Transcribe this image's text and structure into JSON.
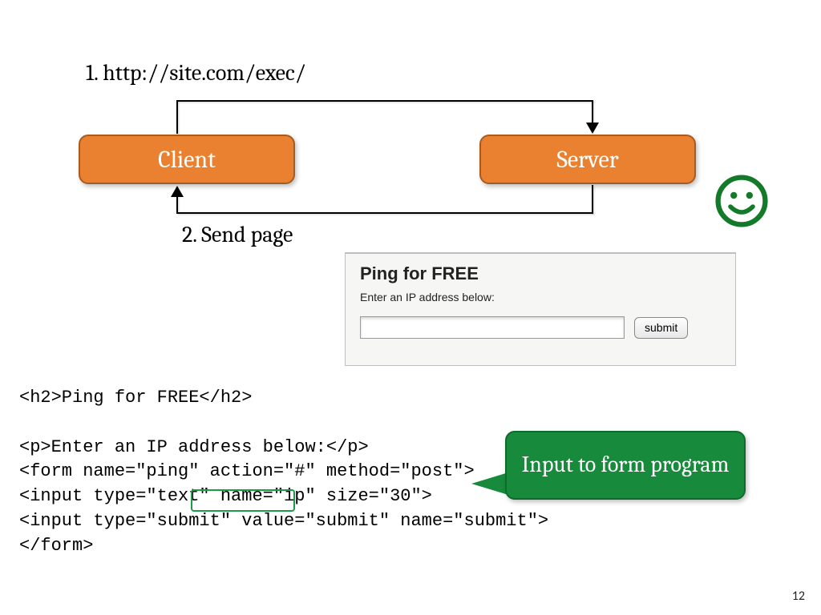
{
  "step1": "1. http://site.com/exec/",
  "step2": "2. Send page",
  "client_label": "Client",
  "server_label": "Server",
  "form": {
    "title": "Ping for FREE",
    "prompt": "Enter an IP address below:",
    "submit_label": "submit"
  },
  "code": {
    "l1": "<h2>Ping for FREE</h2>",
    "l2": "",
    "l3": "<p>Enter an IP address below:</p>",
    "l4": "<form name=\"ping\" action=\"#\" method=\"post\">",
    "l5": "<input type=\"text\" name=\"ip\" size=\"30\">",
    "l6": "<input type=\"submit\" value=\"submit\" name=\"submit\">",
    "l7": "</form>"
  },
  "callout": "Input to form program",
  "page_number": "12"
}
